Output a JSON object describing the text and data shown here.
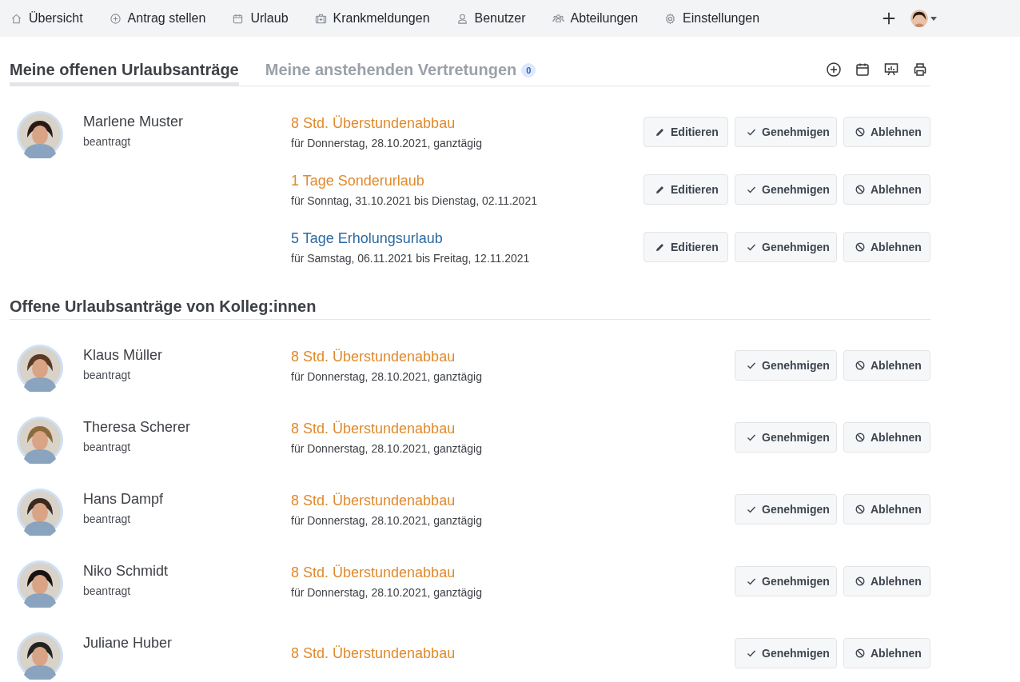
{
  "nav": {
    "items": [
      {
        "label": "Übersicht"
      },
      {
        "label": "Antrag stellen"
      },
      {
        "label": "Urlaub"
      },
      {
        "label": "Krankmeldungen"
      },
      {
        "label": "Benutzer"
      },
      {
        "label": "Abteilungen"
      },
      {
        "label": "Einstellungen"
      }
    ]
  },
  "tabs": [
    {
      "label": "Meine offenen Urlaubsanträge",
      "selected": true
    },
    {
      "label": "Meine anstehenden Vertretungen",
      "selected": false,
      "badge": "0"
    }
  ],
  "my_requests": [
    {
      "name": "Marlene Muster",
      "status": "beantragt",
      "requests": [
        {
          "title": "8 Std. Überstundenabbau",
          "color": "#e08a2c",
          "date": "für Donnerstag, 28.10.2021, ganztägig",
          "actions": [
            {
              "kind": "edit",
              "label": "Editieren"
            },
            {
              "kind": "approve",
              "label": "Genehmigen"
            },
            {
              "kind": "reject",
              "label": "Ablehnen"
            }
          ]
        },
        {
          "title": "1 Tage Sonderurlaub",
          "color": "#e08a2c",
          "date": "für Sonntag, 31.10.2021 bis Dienstag, 02.11.2021",
          "actions": [
            {
              "kind": "edit",
              "label": "Editieren"
            },
            {
              "kind": "approve",
              "label": "Genehmigen"
            },
            {
              "kind": "reject",
              "label": "Ablehnen"
            }
          ]
        },
        {
          "title": "5 Tage Erholungsurlaub",
          "color": "#2d6a9f",
          "date": "für Samstag, 06.11.2021 bis Freitag, 12.11.2021",
          "actions": [
            {
              "kind": "edit",
              "label": "Editieren"
            },
            {
              "kind": "approve",
              "label": "Genehmigen"
            },
            {
              "kind": "reject",
              "label": "Ablehnen"
            }
          ]
        }
      ]
    }
  ],
  "colleagues": {
    "title": "Offene Urlaubsanträge von Kolleg:innen",
    "people": [
      {
        "name": "Klaus Müller",
        "status": "beantragt",
        "requests": [
          {
            "title": "8 Std. Überstundenabbau",
            "color": "#e08a2c",
            "date": "für Donnerstag, 28.10.2021, ganztägig",
            "actions": [
              {
                "kind": "approve",
                "label": "Genehmigen"
              },
              {
                "kind": "reject",
                "label": "Ablehnen"
              }
            ]
          }
        ]
      },
      {
        "name": "Theresa Scherer",
        "status": "beantragt",
        "requests": [
          {
            "title": "8 Std. Überstundenabbau",
            "color": "#e08a2c",
            "date": "für Donnerstag, 28.10.2021, ganztägig",
            "actions": [
              {
                "kind": "approve",
                "label": "Genehmigen"
              },
              {
                "kind": "reject",
                "label": "Ablehnen"
              }
            ]
          }
        ]
      },
      {
        "name": "Hans Dampf",
        "status": "beantragt",
        "requests": [
          {
            "title": "8 Std. Überstundenabbau",
            "color": "#e08a2c",
            "date": "für Donnerstag, 28.10.2021, ganztägig",
            "actions": [
              {
                "kind": "approve",
                "label": "Genehmigen"
              },
              {
                "kind": "reject",
                "label": "Ablehnen"
              }
            ]
          }
        ]
      },
      {
        "name": "Niko Schmidt",
        "status": "beantragt",
        "requests": [
          {
            "title": "8 Std. Überstundenabbau",
            "color": "#e08a2c",
            "date": "für Donnerstag, 28.10.2021, ganztägig",
            "actions": [
              {
                "kind": "approve",
                "label": "Genehmigen"
              },
              {
                "kind": "reject",
                "label": "Ablehnen"
              }
            ]
          }
        ]
      },
      {
        "name": "Juliane Huber",
        "requests": [
          {
            "title": "8 Std. Überstundenabbau",
            "color": "#e08a2c",
            "actions": [
              {
                "kind": "approve",
                "label": "Genehmigen"
              },
              {
                "kind": "reject",
                "label": "Ablehnen"
              }
            ]
          }
        ]
      }
    ]
  }
}
